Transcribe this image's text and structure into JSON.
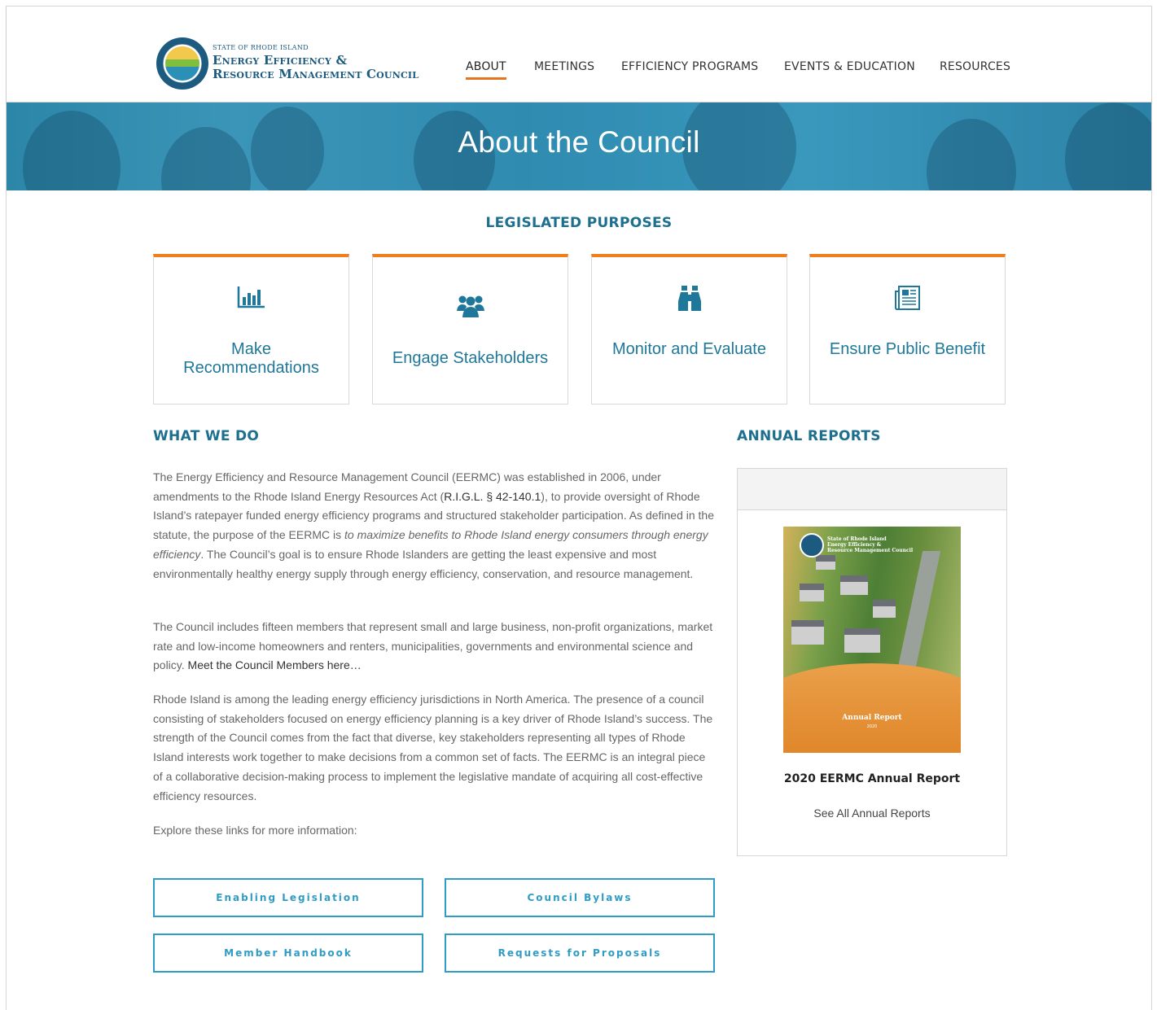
{
  "brand": {
    "line1": "STATE OF RHODE ISLAND",
    "line2": "Energy Efficiency &",
    "line3": "Resource Management Council"
  },
  "nav": {
    "items": [
      {
        "label": "ABOUT",
        "active": true
      },
      {
        "label": "MEETINGS",
        "active": false
      },
      {
        "label": "EFFICIENCY PROGRAMS",
        "active": false
      },
      {
        "label": "EVENTS & EDUCATION",
        "active": false
      },
      {
        "label": "RESOURCES",
        "active": false
      }
    ]
  },
  "banner": {
    "title": "About the Council"
  },
  "purposes": {
    "title": "LEGISLATED PURPOSES",
    "cards": [
      {
        "label": "Make Recommendations",
        "icon": "bar-chart-icon"
      },
      {
        "label": "Engage Stakeholders",
        "icon": "group-icon"
      },
      {
        "label": "Monitor and Evaluate",
        "icon": "binoculars-icon"
      },
      {
        "label": "Ensure Public Benefit",
        "icon": "newspaper-icon"
      }
    ]
  },
  "what_we_do": {
    "title": "WHAT WE DO",
    "p1_a": "The Energy Efficiency and Resource Management Council (EERMC) was established in 2006, under amendments to the Rhode Island Energy Resources Act (",
    "p1_link": "R.I.G.L. § 42-140.1",
    "p1_b": "), to provide oversight of Rhode Island’s ratepayer funded energy efficiency programs and structured stakeholder participation. As defined in the statute, the purpose of the EERMC is ",
    "p1_em": "to maximize benefits to Rhode Island energy consumers through energy efficiency",
    "p1_c": ". The Council’s goal is to ensure Rhode Islanders are getting the least expensive and most environmentally healthy energy supply through energy efficiency, conservation, and resource management.",
    "p2_a": "The Council includes fifteen members that represent small and large business, non-profit organizations, market rate and low-income homeowners and renters, municipalities, governments and environmental science and policy. ",
    "p2_link": "Meet the Council Members here…",
    "p3": "Rhode Island is among the leading energy efficiency jurisdictions in North America. The presence of a council consisting of stakeholders focused on energy efficiency planning is a key driver of Rhode Island’s success. The strength of the Council comes from the fact that diverse, key stakeholders representing all types of Rhode Island interests work together to make decisions from a common set of facts. The EERMC is an integral piece of a collaborative decision-making process to implement the legislative mandate of acquiring all cost-effective efficiency resources.",
    "p4": "Explore these links for more information:"
  },
  "buttons": {
    "enabling": "Enabling Legislation",
    "bylaws": "Council Bylaws",
    "handbook": "Member Handbook",
    "rfp": "Requests for Proposals"
  },
  "reports": {
    "title": "ANNUAL REPORTS",
    "cover_heading_1": "State of Rhode Island",
    "cover_heading_2": "Energy Efficiency &",
    "cover_heading_3": "Resource Management Council",
    "cover_title": "Annual Report",
    "cover_year": "2020",
    "report_title": "2020 EERMC Annual Report",
    "see_all": "See All Annual Reports"
  },
  "colors": {
    "accent_orange": "#f07f1b",
    "brand_teal": "#1d6f8f",
    "button_blue": "#2e9cc4"
  }
}
